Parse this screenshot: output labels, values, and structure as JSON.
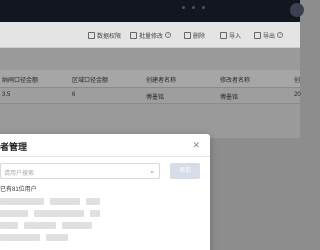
{
  "toolbar": {
    "buttons": [
      {
        "label": "数据权限",
        "icon": "shield-icon"
      },
      {
        "label": "批量修改",
        "icon": "edit-icon"
      },
      {
        "label": "删除",
        "icon": "trash-icon"
      },
      {
        "label": "导入",
        "icon": "import-icon"
      },
      {
        "label": "导出",
        "icon": "export-icon"
      }
    ]
  },
  "table": {
    "headers": [
      "纳闸口径金额",
      "区域口径金额",
      "创建者名称",
      "修改者名称",
      "创"
    ],
    "rows": [
      [
        "3.5",
        "6",
        "傅墨铭",
        "傅墨铭",
        "20"
      ]
    ]
  },
  "modal": {
    "title": "者管理",
    "select_placeholder": "请用户搜索",
    "add_button": "添加",
    "selected_text": "已有81位用户",
    "close_icon": "close-icon"
  },
  "colors": {
    "topbar": "#121620",
    "overlay": "#8d8d8d",
    "modal_bg": "#ffffff",
    "add_button_bg": "#d7dde8"
  }
}
